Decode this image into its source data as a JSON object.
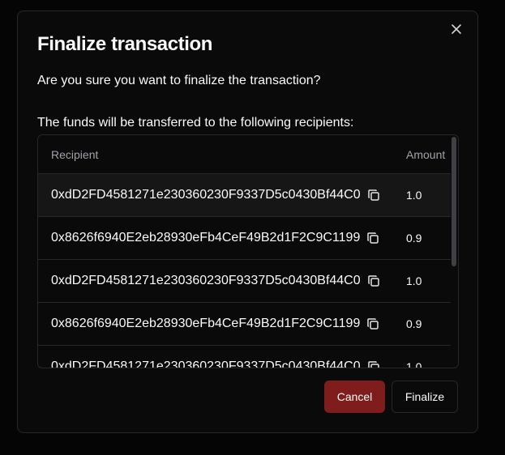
{
  "dialog": {
    "title": "Finalize transaction",
    "question": "Are you sure you want to finalize the transaction?",
    "funds_text": "The funds will be transferred to the following recipients:",
    "close_icon": "close-icon"
  },
  "table": {
    "columns": {
      "recipient": "Recipient",
      "amount": "Amount"
    },
    "rows": [
      {
        "address": "0xdD2FD4581271e230360230F9337D5c0430Bf44C0",
        "amount": "1.0"
      },
      {
        "address": "0x8626f6940E2eb28930eFb4CeF49B2d1F2C9C1199",
        "amount": "0.9"
      },
      {
        "address": "0xdD2FD4581271e230360230F9337D5c0430Bf44C0",
        "amount": "1.0"
      },
      {
        "address": "0x8626f6940E2eb28930eFb4CeF49B2d1F2C9C1199",
        "amount": "0.9"
      },
      {
        "address": "0xdD2FD4581271e230360230F9337D5c0430Bf44C0",
        "amount": "1.0"
      }
    ],
    "copy_icon": "copy-icon"
  },
  "actions": {
    "cancel_label": "Cancel",
    "finalize_label": "Finalize"
  },
  "colors": {
    "background": "#0a0a0a",
    "border": "#27272a",
    "cancel": "#7f1d1d",
    "text": "#fafafa",
    "muted": "#a1a1aa"
  }
}
